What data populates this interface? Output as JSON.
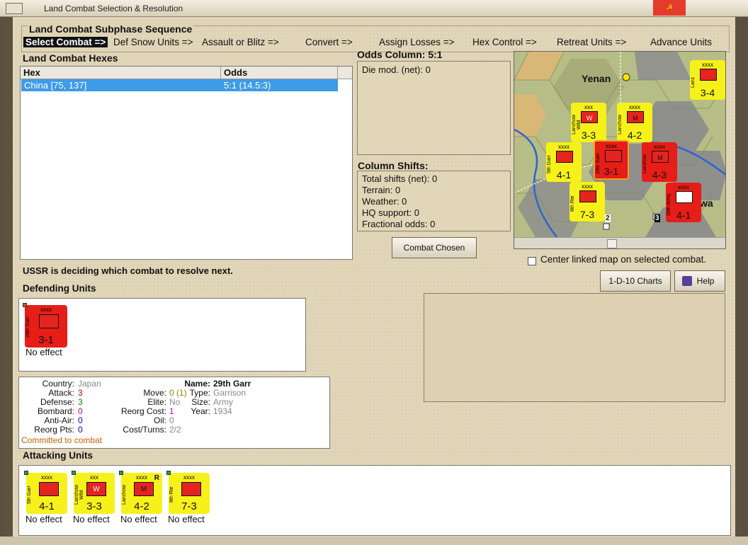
{
  "window": {
    "title": "Land Combat Selection & Resolution",
    "close": "☭"
  },
  "sequence": {
    "label": "Land Combat Subphase Sequence",
    "steps": [
      "Select Combat =>",
      "Def Snow Units =>",
      "Assault or Blitz =>",
      "Convert =>",
      "Assign Losses =>",
      "Hex Control =>",
      "Retreat Units =>",
      "Advance Units"
    ]
  },
  "hexes": {
    "label": "Land Combat Hexes",
    "columns": [
      "Hex",
      "Odds"
    ],
    "rows": [
      {
        "hex": "China [75, 137]",
        "odds": "5:1 (14.5:3)"
      }
    ]
  },
  "odds": {
    "label": "Odds Column: 5:1",
    "die_mod": "Die mod. (net): 0"
  },
  "shifts": {
    "label": "Column Shifts:",
    "lines": [
      "Total shifts (net): 0",
      "Terrain: 0",
      "Weather: 0",
      "HQ support: 0",
      "Fractional odds: 0"
    ]
  },
  "buttons": {
    "combat_chosen": "Combat Chosen",
    "charts": "1-D-10 Charts",
    "help": "Help"
  },
  "map": {
    "city": "Yenan",
    "counters": [
      {
        "name": "Lanchow Wild",
        "size": "xxx",
        "value": "3-3",
        "color": "yellow",
        "symbol": "W"
      },
      {
        "name": "Lanchow",
        "size": "xxxx",
        "value": "4-2",
        "color": "yellow",
        "symbol": "M"
      },
      {
        "name": "5th Garr",
        "size": "xxxx",
        "value": "4-1",
        "color": "yellow"
      },
      {
        "name": "29th Garr",
        "size": "xxxx",
        "value": "3-1",
        "color": "red"
      },
      {
        "name": "Lanzhou",
        "size": "xxxx",
        "value": "4-3",
        "color": "red",
        "symbol": "M"
      },
      {
        "name": "8th Rte",
        "size": "xxxx",
        "value": "7-3",
        "color": "yellow"
      },
      {
        "name": "20th Army",
        "size": "xxxx",
        "value": "4-1",
        "color": "red"
      },
      {
        "name": "Lanz",
        "size": "xxxx",
        "value": "3-4",
        "color": "yellow"
      }
    ],
    "stack_counts": [
      "2",
      "3"
    ],
    "label_fragment": "wa",
    "center_label": "Center linked map on selected combat."
  },
  "status": "USSR is deciding which combat to resolve next.",
  "defending": {
    "label": "Defending Units",
    "units": [
      {
        "name": "29th Garr",
        "size": "xxxx",
        "value": "3-1",
        "effect": "No effect"
      }
    ]
  },
  "detail": {
    "country_l": "Country:",
    "country": "Japan",
    "attack_l": "Attack:",
    "attack": "3",
    "defense_l": "Defense:",
    "defense": "3",
    "bombard_l": "Bombard:",
    "bombard": "0",
    "antiair_l": "Anti-Air:",
    "antiair": "0",
    "reorg_l": "Reorg Pts:",
    "reorg": "0",
    "move_l": "Move:",
    "move": "0 (1)",
    "elite_l": "Elite:",
    "elite": "No",
    "reorgcost_l": "Reorg Cost:",
    "reorgcost": "1",
    "oil_l": "Oil:",
    "oil": "0",
    "cost_l": "Cost/Turns:",
    "cost": "2/2",
    "name_l": "Name:",
    "name": "29th Garr",
    "type_l": "Type:",
    "type": "Garrison",
    "size_l": "Size:",
    "size": "Army",
    "year_l": "Year:",
    "year": "1934",
    "committed": "Committed to combat"
  },
  "attacking": {
    "label": "Attacking Units",
    "units": [
      {
        "name": "5th Garr",
        "size": "xxxx",
        "value": "4-1",
        "effect": "No effect"
      },
      {
        "name": "Lanchow Wild",
        "size": "xxx",
        "value": "3-3",
        "effect": "No effect",
        "symbol": "W"
      },
      {
        "name": "Lanchow",
        "size": "xxxx",
        "value": "4-2",
        "effect": "No effect",
        "symbol": "M",
        "mark": "R"
      },
      {
        "name": "8th Rte",
        "size": "xxxx",
        "value": "7-3",
        "effect": "No effect"
      }
    ]
  },
  "colors": {
    "counter_yellow": "#f6f11a",
    "counter_red": "#e71d17",
    "selection": "#3d9be8",
    "panel": "#dfd3b5"
  }
}
